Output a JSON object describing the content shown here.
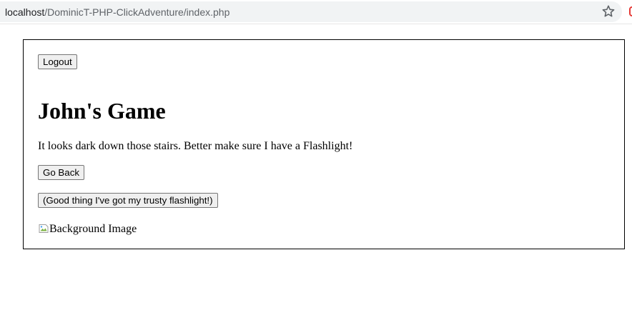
{
  "browser": {
    "url_host": "localhost",
    "url_path": "/DominicT-PHP-ClickAdventure/index.php",
    "bookmark_icon": "star-outline-icon"
  },
  "game": {
    "logout_label": "Logout",
    "title": "John's Game",
    "story_text": "It looks dark down those stairs. Better make sure I have a Flashlight!",
    "go_back_label": "Go Back",
    "flashlight_choice_label": "(Good thing I've got my trusty flashlight!)",
    "image_alt": "Background Image",
    "image_icon": "broken-image-icon"
  }
}
